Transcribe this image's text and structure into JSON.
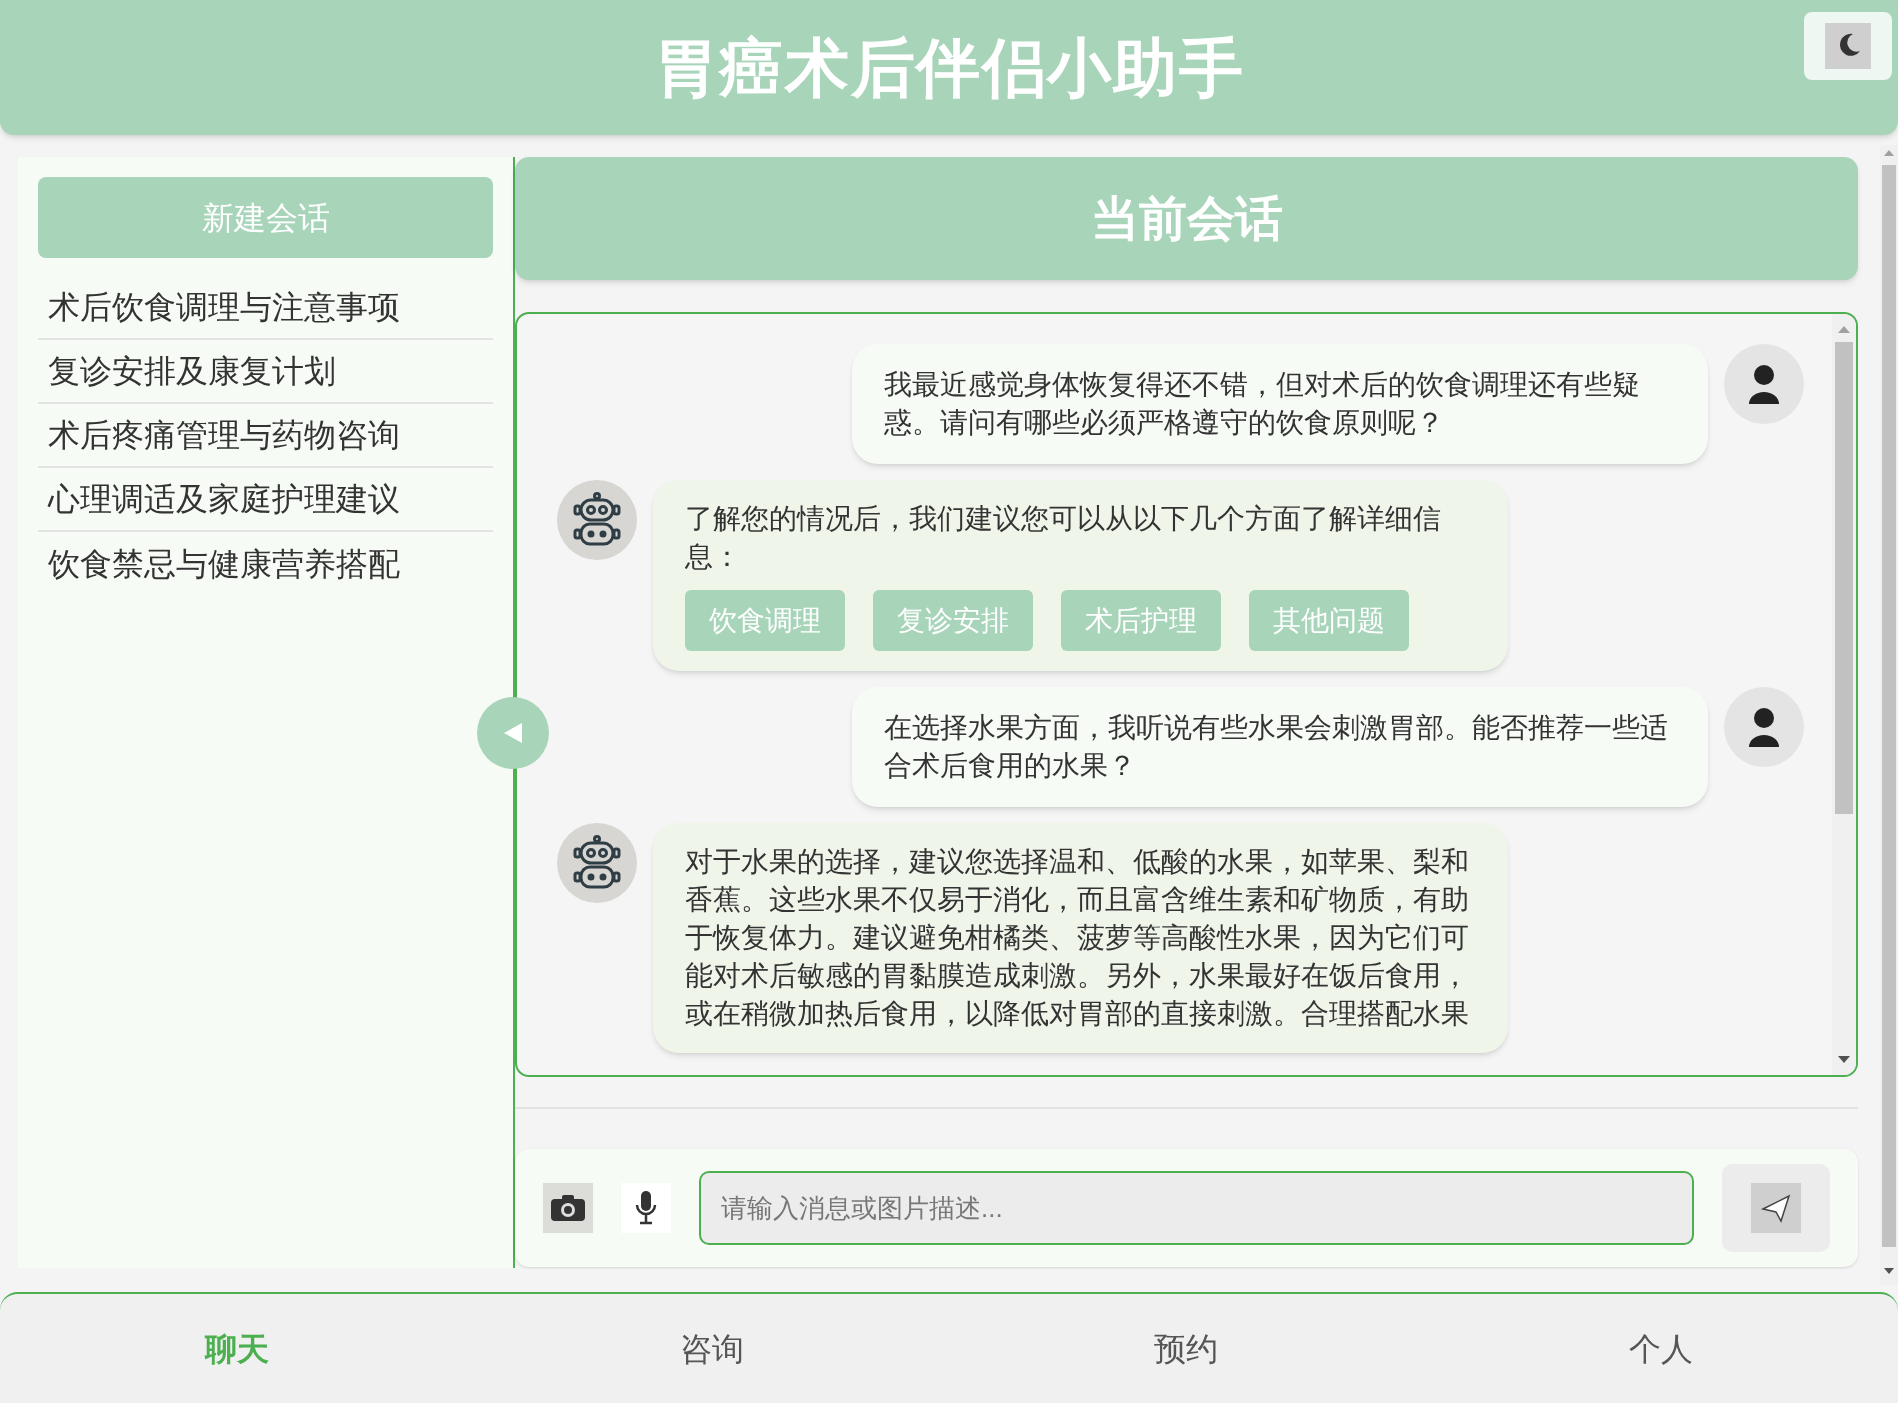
{
  "header": {
    "title": "胃癌术后伴侣小助手"
  },
  "sidebar": {
    "new_chat": "新建会话",
    "items": [
      {
        "label": "术后饮食调理与注意事项"
      },
      {
        "label": "复诊安排及康复计划"
      },
      {
        "label": "术后疼痛管理与药物咨询"
      },
      {
        "label": "心理调适及家庭护理建议"
      },
      {
        "label": "饮食禁忌与健康营养搭配"
      }
    ]
  },
  "chat": {
    "title": "当前会话",
    "messages": [
      {
        "kind": "user",
        "text": "我最近感觉身体恢复得还不错，但对术后的饮食调理还有些疑惑。请问有哪些必须严格遵守的饮食原则呢？"
      },
      {
        "kind": "bot",
        "text": "了解您的情况后，我们建议您可以从以下几个方面了解详细信息：",
        "options": [
          "饮食调理",
          "复诊安排",
          "术后护理",
          "其他问题"
        ]
      },
      {
        "kind": "user",
        "text": "在选择水果方面，我听说有些水果会刺激胃部。能否推荐一些适合术后食用的水果？"
      },
      {
        "kind": "bot",
        "text": "对于水果的选择，建议您选择温和、低酸的水果，如苹果、梨和香蕉。这些水果不仅易于消化，而且富含维生素和矿物质，有助于恢复体力。建议避免柑橘类、菠萝等高酸性水果，因为它们可能对术后敏感的胃黏膜造成刺激。另外，水果最好在饭后食用，或在稍微加热后食用，以降低对胃部的直接刺激。合理搭配水果"
      }
    ],
    "input": {
      "placeholder": "请输入消息或图片描述..."
    }
  },
  "nav": [
    {
      "label": "聊天",
      "selected": true
    },
    {
      "label": "咨询",
      "selected": false
    },
    {
      "label": "预约",
      "selected": false
    },
    {
      "label": "个人",
      "selected": false
    }
  ]
}
